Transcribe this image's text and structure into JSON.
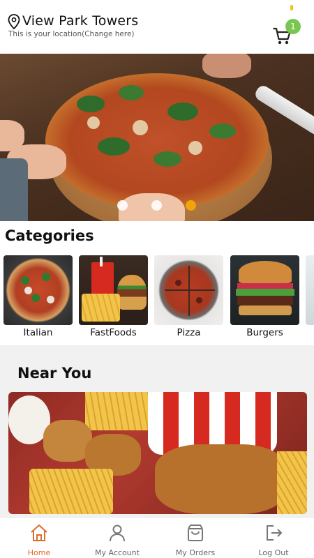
{
  "header": {
    "location_title": "View Park Towers",
    "location_subtitle": "This is your location(Change here)",
    "cart_count": "1"
  },
  "hero": {
    "slide_count": 3,
    "active_slide": 3,
    "image_icon": "pizza-photo"
  },
  "categories": {
    "title": "Categories",
    "items": [
      {
        "label": "Italian",
        "image_icon": "italian-pizza-photo"
      },
      {
        "label": "FastFoods",
        "image_icon": "fastfood-photo"
      },
      {
        "label": "Pizza",
        "image_icon": "pizza-slices-photo"
      },
      {
        "label": "Burgers",
        "image_icon": "burger-photo"
      }
    ]
  },
  "near_you": {
    "title": "Near You",
    "image_icon": "fried-chicken-bucket-photo"
  },
  "nav": {
    "items": [
      {
        "label": "Home",
        "icon": "home-icon",
        "active": true
      },
      {
        "label": "My Account",
        "icon": "user-icon",
        "active": false
      },
      {
        "label": "My Orders",
        "icon": "bag-icon",
        "active": false
      },
      {
        "label": "Log Out",
        "icon": "logout-icon",
        "active": false
      }
    ]
  },
  "colors": {
    "accent": "#e06b2a",
    "badge": "#7ac74f",
    "dot_active": "#f0a30a",
    "dot_inactive": "#ffffff"
  }
}
